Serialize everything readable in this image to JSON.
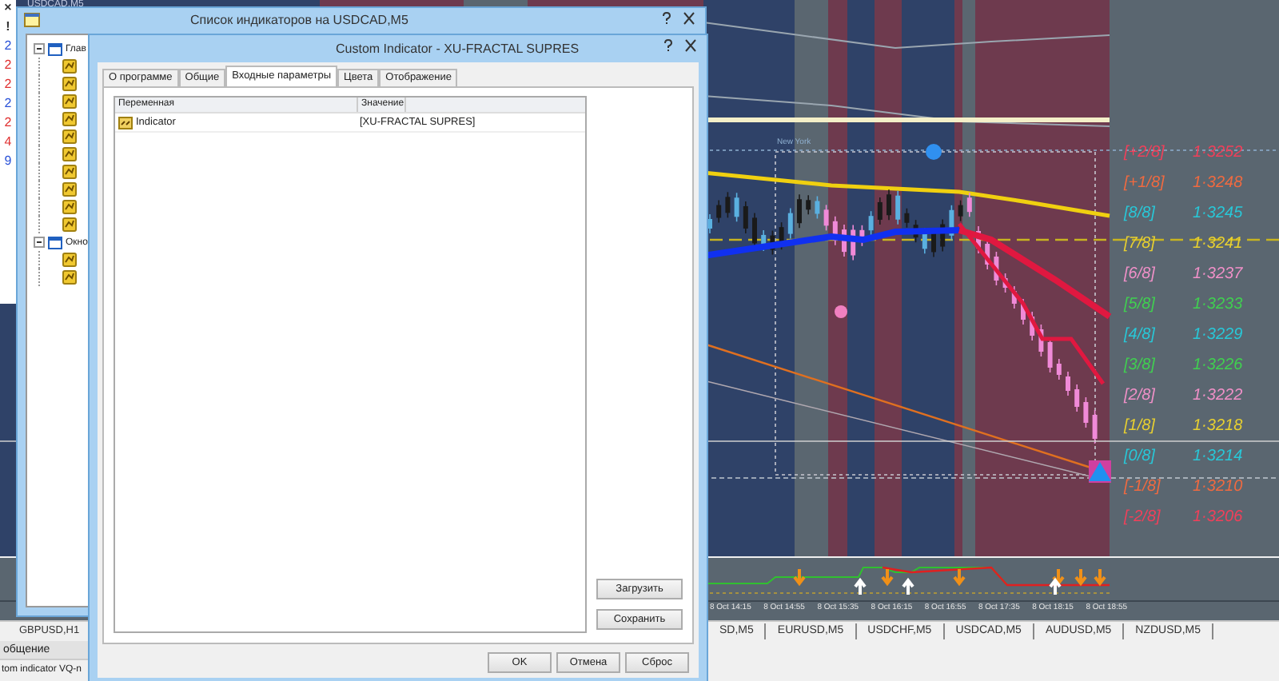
{
  "left_panel": {
    "marks": [
      "×",
      "!"
    ],
    "digits": [
      {
        "text": "2",
        "color": "#2a52d8"
      },
      {
        "text": "2",
        "color": "#e03030"
      },
      {
        "text": "2",
        "color": "#e03030"
      },
      {
        "text": "2",
        "color": "#2a52d8"
      },
      {
        "text": "2",
        "color": "#e03030"
      },
      {
        "text": "4",
        "color": "#e03030"
      },
      {
        "text": "9",
        "color": "#2a52d8"
      }
    ]
  },
  "chart": {
    "title": "USDCAD,M5",
    "session_label": "New York",
    "levels": [
      {
        "label": "[+2/8]",
        "price": "1·3252",
        "color": "#f0405a"
      },
      {
        "label": "[+1/8]",
        "price": "1·3248",
        "color": "#f06a40"
      },
      {
        "label": "[8/8]",
        "price": "1·3245",
        "color": "#28c8d8"
      },
      {
        "label": "[7/8]",
        "price": "1·3241",
        "color": "#e8d030"
      },
      {
        "label": "[6/8]",
        "price": "1·3237",
        "color": "#f090c8"
      },
      {
        "label": "[5/8]",
        "price": "1·3233",
        "color": "#40d050"
      },
      {
        "label": "[4/8]",
        "price": "1·3229",
        "color": "#28c8d8"
      },
      {
        "label": "[3/8]",
        "price": "1·3226",
        "color": "#40d050"
      },
      {
        "label": "[2/8]",
        "price": "1·3222",
        "color": "#f090c8"
      },
      {
        "label": "[1/8]",
        "price": "1·3218",
        "color": "#e8d030"
      },
      {
        "label": "[0/8]",
        "price": "1·3214",
        "color": "#28c8d8"
      },
      {
        "label": "[-1/8]",
        "price": "1·3210",
        "color": "#f06a40"
      },
      {
        "label": "[-2/8]",
        "price": "1·3206",
        "color": "#f0405a"
      }
    ],
    "time_labels": [
      "8 Oct 14:15",
      "8 Oct 14:55",
      "8 Oct 15:35",
      "8 Oct 16:15",
      "8 Oct 16:55",
      "8 Oct 17:35",
      "8 Oct 18:15",
      "8 Oct 18:55"
    ]
  },
  "indicator_list_window": {
    "title": "Список индикаторов на USDCAD,M5",
    "tree": [
      {
        "label": "Глав",
        "expanded": true,
        "children": [
          {
            "kind": "indicator"
          },
          {
            "kind": "indicator"
          },
          {
            "kind": "indicator"
          },
          {
            "kind": "indicator"
          },
          {
            "kind": "indicator"
          },
          {
            "kind": "indicator"
          },
          {
            "kind": "indicator"
          },
          {
            "kind": "indicator"
          },
          {
            "kind": "indicator"
          },
          {
            "kind": "indicator"
          }
        ]
      },
      {
        "label": "Окно",
        "expanded": true,
        "children": [
          {
            "kind": "indicator"
          },
          {
            "kind": "indicator"
          }
        ]
      }
    ]
  },
  "dialog": {
    "title": "Custom Indicator - XU-FRACTAL SUPRES",
    "tabs": [
      {
        "label": "О программе",
        "selected": false
      },
      {
        "label": "Общие",
        "selected": false
      },
      {
        "label": "Входные параметры",
        "selected": true
      },
      {
        "label": "Цвета",
        "selected": false
      },
      {
        "label": "Отображение",
        "selected": false
      }
    ],
    "table": {
      "columns": [
        "Переменная",
        "Значение"
      ],
      "rows": [
        {
          "variable": "Indicator",
          "value": "[XU-FRACTAL SUPRES]"
        }
      ]
    },
    "side_buttons": [
      "Загрузить",
      "Сохранить"
    ],
    "buttons": [
      "OK",
      "Отмена",
      "Сброс"
    ]
  },
  "chart_tabs": {
    "left": [
      "GBPUSD,H1"
    ],
    "right": [
      "SD,M5",
      "EURUSD,M5",
      "USDCHF,M5",
      "USDCAD,M5",
      "AUDUSD,M5",
      "NZDUSD,M5"
    ]
  },
  "status": {
    "tab": "общение",
    "message": "tom indicator VQ-n"
  }
}
